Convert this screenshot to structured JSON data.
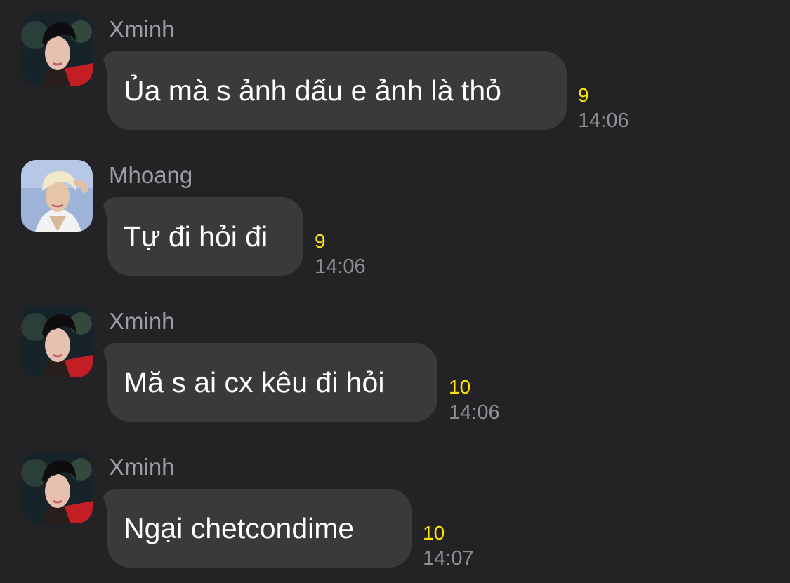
{
  "messages": [
    {
      "sender": "Xminh",
      "text": "Ủa mà s ảnh dấu e ảnh là thỏ",
      "count": "9",
      "time": "14:06",
      "avatar": "xminh-avatar"
    },
    {
      "sender": "Mhoang",
      "text": "Tự đi hỏi đi",
      "count": "9",
      "time": "14:06",
      "avatar": "mhoang-avatar"
    },
    {
      "sender": "Xminh",
      "text": "Mă s ai cx kêu đi hỏi",
      "count": "10",
      "time": "14:06",
      "avatar": "xminh-avatar"
    },
    {
      "sender": "Xminh",
      "text": "Ngại chetcondime",
      "count": "10",
      "time": "14:07",
      "avatar": "xminh-avatar"
    }
  ],
  "colors": {
    "background": "#232325",
    "bubble": "#3a3a3c",
    "sender": "#9c9ca1",
    "count": "#ffe600",
    "time": "#8e8e93",
    "text": "#ffffff"
  }
}
